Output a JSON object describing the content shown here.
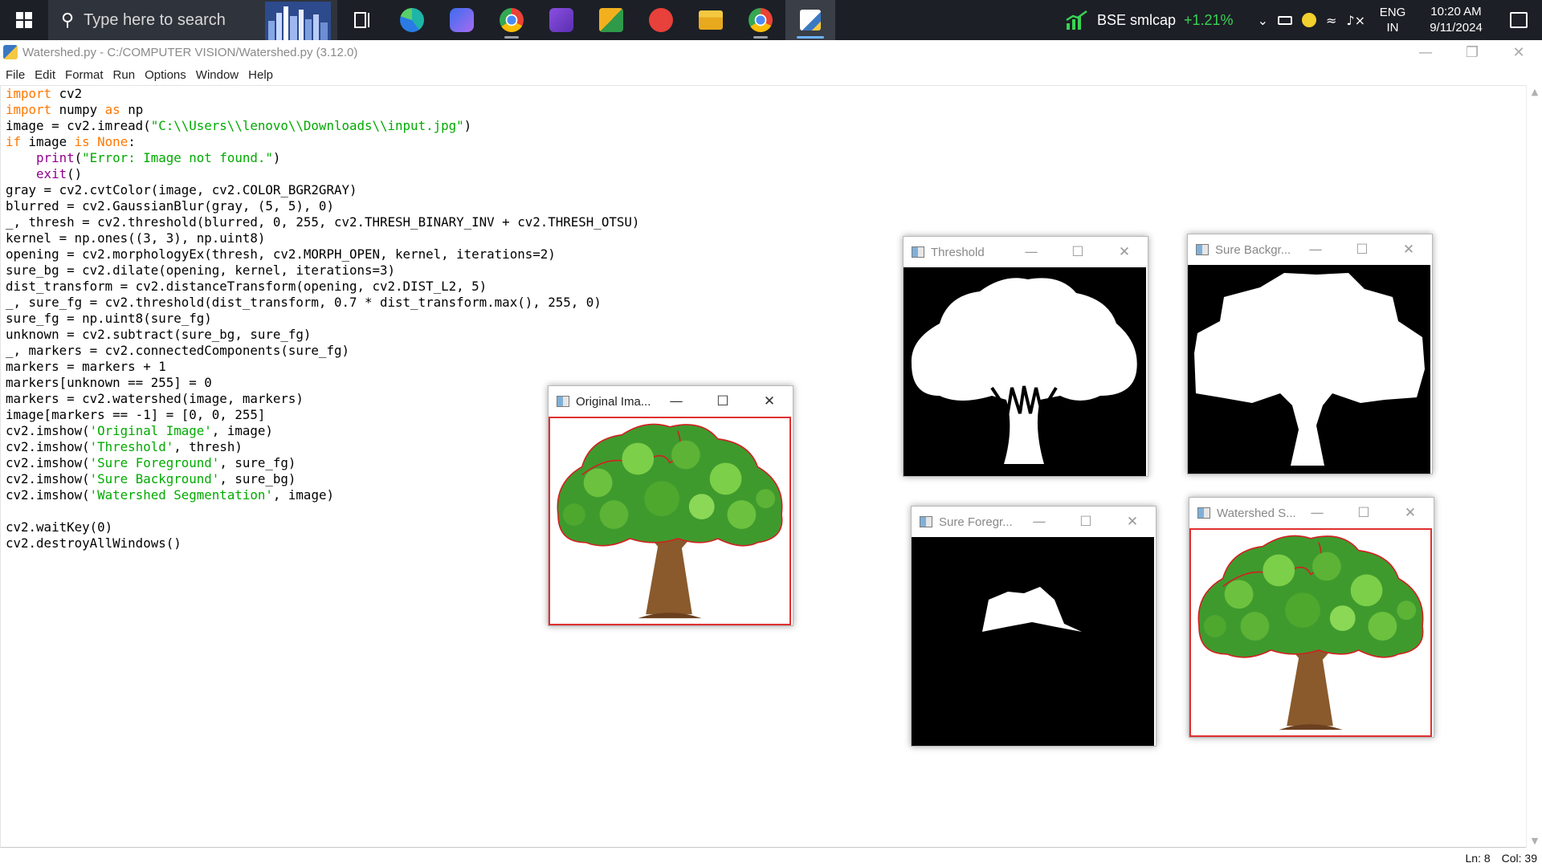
{
  "taskbar": {
    "search_placeholder": "Type here to search",
    "apps": [
      {
        "name": "Task View"
      },
      {
        "name": "Microsoft Edge"
      },
      {
        "name": "Media Player"
      },
      {
        "name": "Google Chrome"
      },
      {
        "name": "Visual Studio"
      },
      {
        "name": "Snipping Tool"
      },
      {
        "name": "WPS Office"
      },
      {
        "name": "File Explorer"
      },
      {
        "name": "Chrome Profile"
      },
      {
        "name": "IDLE"
      }
    ],
    "stock": {
      "name": "BSE smlcap",
      "change": "+1.21%"
    },
    "lang_top": "ENG",
    "lang_bottom": "IN",
    "time": "10:20 AM",
    "date": "9/11/2024"
  },
  "idle": {
    "title": "Watershed.py - C:/COMPUTER VISION/Watershed.py (3.12.0)",
    "menu": [
      "File",
      "Edit",
      "Format",
      "Run",
      "Options",
      "Window",
      "Help"
    ],
    "status": {
      "line": "Ln: 8",
      "col": "Col: 39"
    }
  },
  "code_lines": [
    [
      {
        "t": "import",
        "c": "kw"
      },
      {
        "t": " cv2"
      }
    ],
    [
      {
        "t": "import",
        "c": "kw"
      },
      {
        "t": " numpy "
      },
      {
        "t": "as",
        "c": "kw"
      },
      {
        "t": " np"
      }
    ],
    [
      {
        "t": "image = cv2.imread("
      },
      {
        "t": "\"C:\\\\Users\\\\lenovo\\\\Downloads\\\\input.jpg\"",
        "c": "str"
      },
      {
        "t": ")"
      }
    ],
    [
      {
        "t": "if",
        "c": "kw"
      },
      {
        "t": " image "
      },
      {
        "t": "is",
        "c": "kw"
      },
      {
        "t": " "
      },
      {
        "t": "None",
        "c": "kw"
      },
      {
        "t": ":"
      }
    ],
    [
      {
        "t": "    "
      },
      {
        "t": "print",
        "c": "bi"
      },
      {
        "t": "("
      },
      {
        "t": "\"Error: Image not found.\"",
        "c": "str"
      },
      {
        "t": ")"
      }
    ],
    [
      {
        "t": "    "
      },
      {
        "t": "exit",
        "c": "bi"
      },
      {
        "t": "()"
      }
    ],
    [
      {
        "t": "gray = cv2.cvtColor(image, cv2.COLOR_BGR2GRAY)"
      }
    ],
    [
      {
        "t": "blurred = cv2.GaussianBlur(gray, (5, 5), 0)"
      }
    ],
    [
      {
        "t": "_, thresh = cv2.threshold(blurred, 0, 255, cv2.THRESH_BINARY_INV + cv2.THRESH_OTSU)"
      }
    ],
    [
      {
        "t": "kernel = np.ones((3, 3), np.uint8)"
      }
    ],
    [
      {
        "t": "opening = cv2.morphologyEx(thresh, cv2.MORPH_OPEN, kernel, iterations=2)"
      }
    ],
    [
      {
        "t": "sure_bg = cv2.dilate(opening, kernel, iterations=3)"
      }
    ],
    [
      {
        "t": "dist_transform = cv2.distanceTransform(opening, cv2.DIST_L2, 5)"
      }
    ],
    [
      {
        "t": "_, sure_fg = cv2.threshold(dist_transform, 0.7 * dist_transform.max(), 255, 0)"
      }
    ],
    [
      {
        "t": "sure_fg = np.uint8(sure_fg)"
      }
    ],
    [
      {
        "t": "unknown = cv2.subtract(sure_bg, sure_fg)"
      }
    ],
    [
      {
        "t": "_, markers = cv2.connectedComponents(sure_fg)"
      }
    ],
    [
      {
        "t": "markers = markers + 1"
      }
    ],
    [
      {
        "t": "markers[unknown == 255] = 0"
      }
    ],
    [
      {
        "t": "markers = cv2.watershed(image, markers)"
      }
    ],
    [
      {
        "t": "image[markers == -1] = [0, 0, 255]"
      }
    ],
    [
      {
        "t": "cv2.imshow("
      },
      {
        "t": "'Original Image'",
        "c": "str"
      },
      {
        "t": ", image)"
      }
    ],
    [
      {
        "t": "cv2.imshow("
      },
      {
        "t": "'Threshold'",
        "c": "str"
      },
      {
        "t": ", thresh)"
      }
    ],
    [
      {
        "t": "cv2.imshow("
      },
      {
        "t": "'Sure Foreground'",
        "c": "str"
      },
      {
        "t": ", sure_fg)"
      }
    ],
    [
      {
        "t": "cv2.imshow("
      },
      {
        "t": "'Sure Background'",
        "c": "str"
      },
      {
        "t": ", sure_bg)"
      }
    ],
    [
      {
        "t": "cv2.imshow("
      },
      {
        "t": "'Watershed Segmentation'",
        "c": "str"
      },
      {
        "t": ", image)"
      }
    ],
    [
      {
        "t": ""
      }
    ],
    [
      {
        "t": "cv2.waitKey(0)"
      }
    ],
    [
      {
        "t": "cv2.destroyAllWindows()"
      }
    ]
  ],
  "windows": {
    "original": {
      "title": "Original Ima..."
    },
    "threshold": {
      "title": "Threshold"
    },
    "sure_bg": {
      "title": "Sure Backgr..."
    },
    "sure_fg": {
      "title": "Sure Foregr..."
    },
    "watershed": {
      "title": "Watershed S..."
    }
  },
  "colors": {
    "keyword": "#ff7700",
    "string": "#00aa00",
    "builtin": "#900090",
    "taskbar": "#1c1f26",
    "marker_boundary": "#e03030"
  }
}
